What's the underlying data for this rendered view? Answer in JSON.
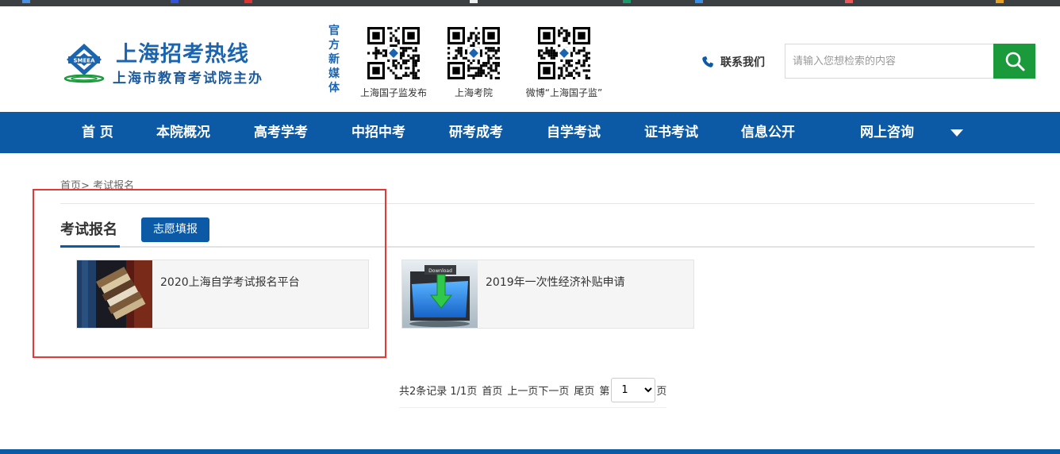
{
  "colors": {
    "brand_blue": "#0c5aa6",
    "title_blue": "#1b64b0",
    "search_green": "#1a9a3a",
    "highlight_red": "#e53935"
  },
  "header": {
    "site_title": "上海招考热线",
    "site_subtitle": "上海市教育考试院主办",
    "logo_text": "SMEEA",
    "media_label": "官方新媒体",
    "qr_codes": [
      {
        "caption": "上海国子监发布",
        "icon": "qr-code-icon"
      },
      {
        "caption": "上海考院",
        "icon": "qr-code-icon"
      },
      {
        "caption": "微博“上海国子监”",
        "icon": "qr-code-icon"
      }
    ],
    "contact_label": "联系我们",
    "search_placeholder": "请输入您想检索的内容",
    "search_value": ""
  },
  "nav": {
    "items": [
      "首 页",
      "本院概况",
      "高考学考",
      "中招中考",
      "研考成考",
      "自学考试",
      "证书考试",
      "信息公开",
      "网上咨询"
    ]
  },
  "breadcrumb": {
    "home": "首页",
    "separator": ">",
    "current": "考试报名"
  },
  "section": {
    "title": "考试报名",
    "tab_button": "志愿填报"
  },
  "cards": [
    {
      "title": "2020上海自学考试报名平台",
      "thumb": "books-image"
    },
    {
      "title": "2019年一次性经济补贴申请",
      "thumb": "download-folder-image"
    }
  ],
  "pagination": {
    "summary": "共2条记录 1/1页",
    "first": "首页",
    "prev": "上一页",
    "next": "下一页",
    "last": "尾页",
    "page_prefix": "第",
    "page_suffix": "页",
    "page_options": [
      "1"
    ],
    "current_page": "1"
  }
}
